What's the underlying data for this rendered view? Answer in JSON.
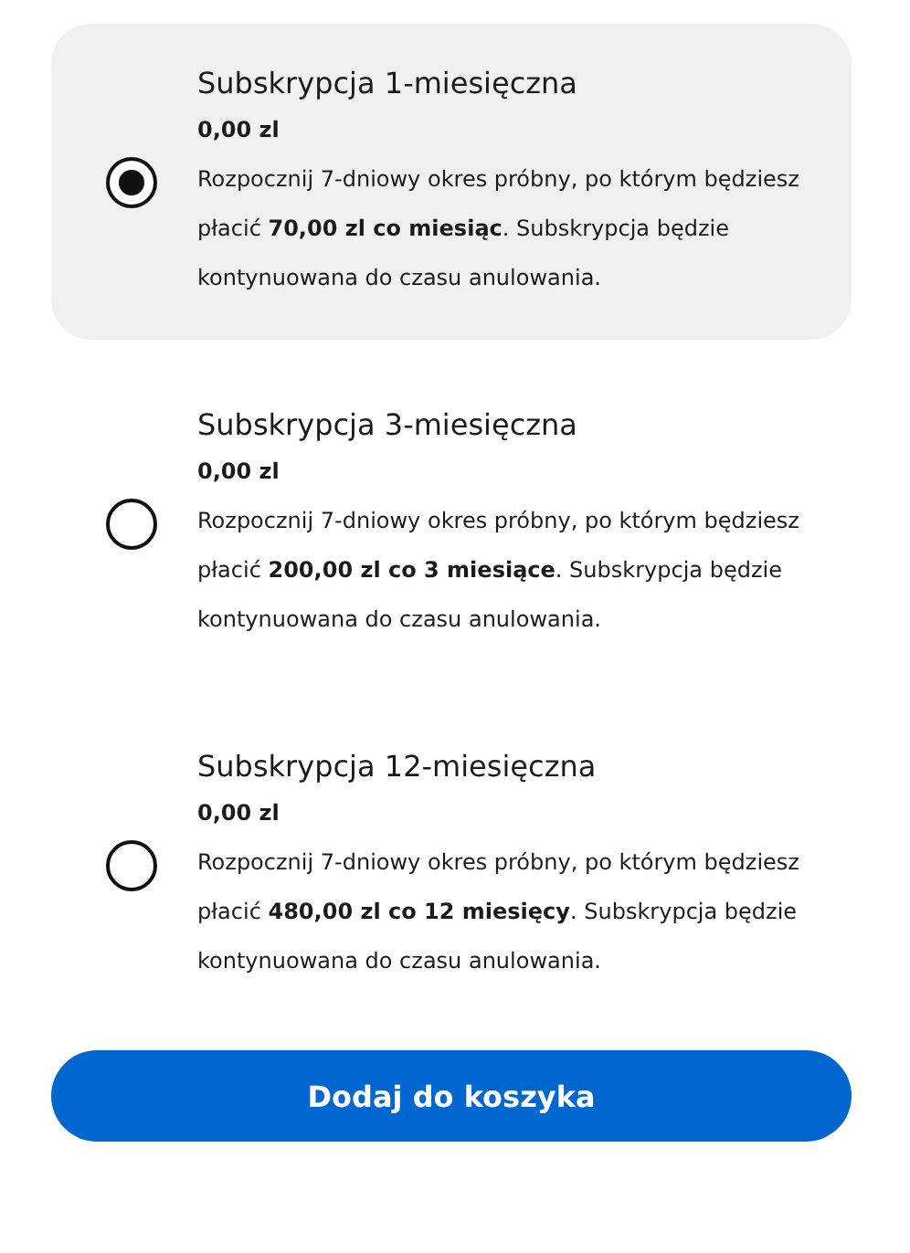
{
  "plans": [
    {
      "title": "Subskrypcja 1-miesięczna",
      "price": "0,00 zl",
      "description": "Rozpocznij 7-dniowy okres próbny, po którym będziesz płacić **70,00 zl co miesiąc**. Subskrypcja będzie kontynuowana do czasu anulowania.",
      "selected": true
    },
    {
      "title": "Subskrypcja 3-miesięczna",
      "price": "0,00 zl",
      "description": "Rozpocznij 7-dniowy okres próbny, po którym będziesz płacić **200,00 zl co 3 miesiące**. Subskrypcja będzie kontynuowana do czasu anulowania.",
      "selected": false
    },
    {
      "title": "Subskrypcja 12-miesięczna",
      "price": "0,00 zl",
      "description": "Rozpocznij 7-dniowy okres próbny, po którym będziesz płacić **480,00 zl co 12 miesięcy**. Subskrypcja będzie kontynuowana do czasu anulowania.",
      "selected": false
    }
  ],
  "button": "Dodaj do koszyka"
}
